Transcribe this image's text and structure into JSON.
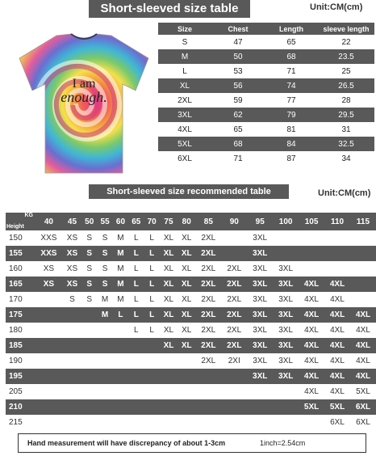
{
  "size_chart": {
    "title": "Short-sleeved size table",
    "unit": "Unit:CM(cm)",
    "headers": [
      "Size",
      "Chest",
      "Length",
      "sleeve length"
    ],
    "rows": [
      [
        "S",
        "47",
        "65",
        "22"
      ],
      [
        "M",
        "50",
        "68",
        "23.5"
      ],
      [
        "L",
        "53",
        "71",
        "25"
      ],
      [
        "XL",
        "56",
        "74",
        "26.5"
      ],
      [
        "2XL",
        "59",
        "77",
        "28"
      ],
      [
        "3XL",
        "62",
        "79",
        "29.5"
      ],
      [
        "4XL",
        "65",
        "81",
        "31"
      ],
      [
        "5XL",
        "68",
        "84",
        "32.5"
      ],
      [
        "6XL",
        "71",
        "87",
        "34"
      ]
    ]
  },
  "shirt": {
    "print_line1": "I am",
    "print_line2": "enough."
  },
  "recommend": {
    "title": "Short-sleeved size recommended table",
    "unit": "Unit:CM(cm)",
    "corner_kg": "KG",
    "corner_height": "Height",
    "weights": [
      "40",
      "45",
      "50",
      "55",
      "60",
      "65",
      "70",
      "75",
      "80",
      "85",
      "90",
      "95",
      "100",
      "105",
      "110",
      "115"
    ],
    "rows": [
      {
        "height": "150",
        "cells": [
          "XXS",
          "XS",
          "S",
          "S",
          "M",
          "L",
          "L",
          "XL",
          "XL",
          "2XL",
          "",
          "3XL",
          "",
          "",
          "",
          ""
        ]
      },
      {
        "height": "155",
        "cells": [
          "XXS",
          "XS",
          "S",
          "S",
          "M",
          "L",
          "L",
          "XL",
          "XL",
          "2XL",
          "",
          "3XL",
          "",
          "",
          "",
          ""
        ]
      },
      {
        "height": "160",
        "cells": [
          "XS",
          "XS",
          "S",
          "S",
          "M",
          "L",
          "L",
          "XL",
          "XL",
          "2XL",
          "2XL",
          "3XL",
          "3XL",
          "",
          "",
          ""
        ]
      },
      {
        "height": "165",
        "cells": [
          "XS",
          "XS",
          "S",
          "S",
          "M",
          "L",
          "L",
          "XL",
          "XL",
          "2XL",
          "2XL",
          "3XL",
          "3XL",
          "4XL",
          "4XL",
          ""
        ]
      },
      {
        "height": "170",
        "cells": [
          "",
          "S",
          "S",
          "M",
          "M",
          "L",
          "L",
          "XL",
          "XL",
          "2XL",
          "2XL",
          "3XL",
          "3XL",
          "4XL",
          "4XL",
          ""
        ]
      },
      {
        "height": "175",
        "cells": [
          "",
          "",
          "",
          "M",
          "L",
          "L",
          "L",
          "XL",
          "XL",
          "2XL",
          "2XL",
          "3XL",
          "3XL",
          "4XL",
          "4XL",
          "4XL"
        ]
      },
      {
        "height": "180",
        "cells": [
          "",
          "",
          "",
          "",
          "",
          "L",
          "L",
          "XL",
          "XL",
          "2XL",
          "2XL",
          "3XL",
          "3XL",
          "4XL",
          "4XL",
          "4XL"
        ]
      },
      {
        "height": "185",
        "cells": [
          "",
          "",
          "",
          "",
          "",
          "",
          "",
          "XL",
          "XL",
          "2XL",
          "2XL",
          "3XL",
          "3XL",
          "4XL",
          "4XL",
          "4XL"
        ]
      },
      {
        "height": "190",
        "cells": [
          "",
          "",
          "",
          "",
          "",
          "",
          "",
          "",
          "",
          "2XL",
          "2XI",
          "3XL",
          "3XL",
          "4XL",
          "4XL",
          "4XL"
        ]
      },
      {
        "height": "195",
        "cells": [
          "",
          "",
          "",
          "",
          "",
          "",
          "",
          "",
          "",
          "",
          "",
          "3XL",
          "3XL",
          "4XL",
          "4XL",
          "4XL"
        ]
      },
      {
        "height": "205",
        "cells": [
          "",
          "",
          "",
          "",
          "",
          "",
          "",
          "",
          "",
          "",
          "",
          "",
          "",
          "4XL",
          "4XL",
          "5XL"
        ]
      },
      {
        "height": "210",
        "cells": [
          "",
          "",
          "",
          "",
          "",
          "",
          "",
          "",
          "",
          "",
          "",
          "",
          "",
          "5XL",
          "5XL",
          "6XL"
        ]
      },
      {
        "height": "215",
        "cells": [
          "",
          "",
          "",
          "",
          "",
          "",
          "",
          "",
          "",
          "",
          "",
          "",
          "",
          "",
          "6XL",
          "6XL"
        ]
      }
    ]
  },
  "footer": {
    "note": "Hand measurement will have discrepancy of about  1-3cm",
    "conversion": "1inch=2.54cm"
  },
  "colors": {
    "bar_gray": "#595959",
    "background": "#ffffff"
  }
}
